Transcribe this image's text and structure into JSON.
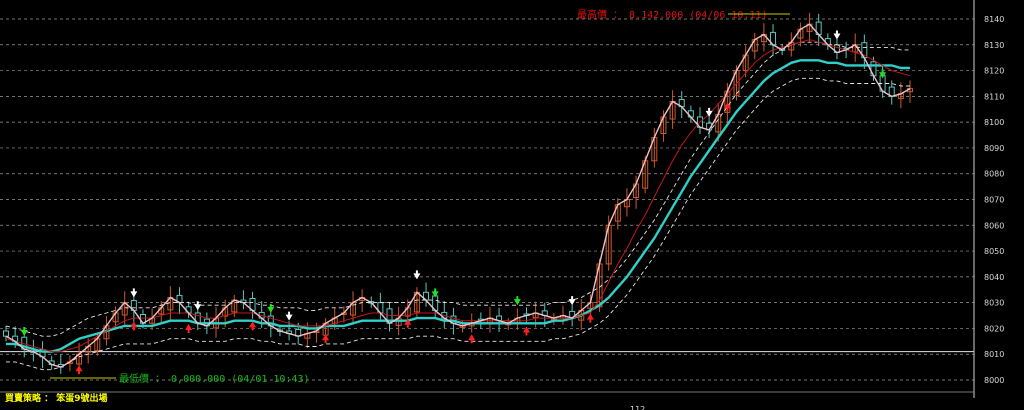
{
  "chart_data": {
    "type": "candlestick",
    "y_axis": {
      "ticks": [
        8140,
        8130,
        8120,
        8110,
        8100,
        8090,
        8080,
        8070,
        8060,
        8050,
        8040,
        8030,
        8020,
        8010,
        8000
      ],
      "min": 7995,
      "max": 8145,
      "reference_line": 8011
    },
    "annotations": {
      "high": "最高價 ： 8,142.000 (04/06 10:11)",
      "low": "最低價 ： 0,000.000 (04/01 10:43)"
    },
    "series": [
      {
        "key": "close",
        "values": [
          8017,
          8015,
          8012,
          8011,
          8009,
          8006,
          8005,
          8007,
          8010,
          8013,
          8016,
          8021,
          8026,
          8030,
          8027,
          8022,
          8024,
          8028,
          8032,
          8030,
          8026,
          8022,
          8021,
          8024,
          8028,
          8031,
          8030,
          8027,
          8024,
          8021,
          8019,
          8018,
          8017,
          8018,
          8019,
          8022,
          8024,
          8026,
          8030,
          8032,
          8030,
          8026,
          8022,
          8024,
          8028,
          8034,
          8031,
          8027,
          8024,
          8022,
          8021,
          8022,
          8023,
          8024,
          8023,
          8022,
          8024,
          8025,
          8026,
          8025,
          8024,
          8025,
          8024,
          8027,
          8030,
          8045,
          8060,
          8068,
          8070,
          8076,
          8085,
          8094,
          8102,
          8108,
          8106,
          8102,
          8098,
          8097,
          8103,
          8112,
          8120,
          8126,
          8132,
          8134,
          8130,
          8128,
          8131,
          8136,
          8138,
          8134,
          8130,
          8127,
          8128,
          8130,
          8125,
          8118,
          8112,
          8110,
          8111,
          8113
        ]
      },
      {
        "key": "upper_band",
        "values": [
          8021,
          8020,
          8019,
          8018,
          8017,
          8017,
          8018,
          8020,
          8022,
          8024,
          8025,
          8026,
          8027,
          8028,
          8028,
          8028,
          8028,
          8029,
          8030,
          8030,
          8030,
          8029,
          8029,
          8029,
          8029,
          8030,
          8030,
          8030,
          8029,
          8029,
          8028,
          8028,
          8028,
          8027,
          8027,
          8028,
          8028,
          8028,
          8029,
          8030,
          8030,
          8030,
          8030,
          8030,
          8030,
          8031,
          8031,
          8031,
          8030,
          8030,
          8029,
          8029,
          8029,
          8029,
          8029,
          8029,
          8029,
          8029,
          8029,
          8029,
          8030,
          8030,
          8031,
          8032,
          8034,
          8036,
          8039,
          8043,
          8047,
          8052,
          8057,
          8062,
          8068,
          8074,
          8080,
          8086,
          8091,
          8096,
          8101,
          8106,
          8111,
          8115,
          8119,
          8123,
          8126,
          8128,
          8130,
          8131,
          8131,
          8131,
          8130,
          8130,
          8129,
          8129,
          8129,
          8129,
          8129,
          8129,
          8128,
          8128
        ]
      },
      {
        "key": "middle",
        "values": [
          8014,
          8014,
          8013,
          8012,
          8011,
          8011,
          8012,
          8014,
          8016,
          8017,
          8018,
          8019,
          8020,
          8021,
          8021,
          8021,
          8021,
          8022,
          8023,
          8023,
          8023,
          8022,
          8022,
          8022,
          8022,
          8023,
          8023,
          8023,
          8022,
          8022,
          8021,
          8021,
          8021,
          8020,
          8020,
          8021,
          8021,
          8021,
          8022,
          8023,
          8023,
          8023,
          8023,
          8023,
          8023,
          8024,
          8024,
          8024,
          8023,
          8023,
          8022,
          8022,
          8022,
          8022,
          8022,
          8022,
          8022,
          8022,
          8022,
          8022,
          8023,
          8023,
          8024,
          8025,
          8027,
          8029,
          8032,
          8036,
          8040,
          8045,
          8050,
          8055,
          8061,
          8067,
          8073,
          8079,
          8084,
          8089,
          8094,
          8099,
          8104,
          8108,
          8112,
          8116,
          8119,
          8121,
          8123,
          8124,
          8124,
          8124,
          8123,
          8123,
          8122,
          8122,
          8122,
          8122,
          8122,
          8122,
          8121,
          8121
        ]
      },
      {
        "key": "lower_band",
        "values": [
          8007,
          8007,
          8006,
          8005,
          8004,
          8004,
          8005,
          8007,
          8009,
          8010,
          8011,
          8012,
          8013,
          8014,
          8014,
          8014,
          8014,
          8015,
          8016,
          8016,
          8016,
          8015,
          8015,
          8015,
          8015,
          8016,
          8016,
          8016,
          8015,
          8015,
          8014,
          8014,
          8014,
          8013,
          8013,
          8014,
          8014,
          8014,
          8015,
          8016,
          8016,
          8016,
          8016,
          8016,
          8016,
          8017,
          8017,
          8017,
          8016,
          8016,
          8015,
          8015,
          8015,
          8015,
          8015,
          8015,
          8015,
          8015,
          8015,
          8015,
          8016,
          8016,
          8017,
          8018,
          8020,
          8022,
          8025,
          8029,
          8033,
          8038,
          8043,
          8048,
          8054,
          8060,
          8066,
          8072,
          8077,
          8082,
          8087,
          8092,
          8097,
          8101,
          8105,
          8109,
          8112,
          8114,
          8116,
          8117,
          8117,
          8117,
          8116,
          8116,
          8115,
          8115,
          8115,
          8115,
          8115,
          8115,
          8114,
          8114
        ]
      },
      {
        "key": "slow_ma",
        "values": [
          8016,
          8015,
          8014,
          8013,
          8012,
          8011,
          8011,
          8012,
          8013,
          8015,
          8017,
          8019,
          8021,
          8023,
          8024,
          8024,
          8024,
          8025,
          8026,
          8026,
          8026,
          8025,
          8024,
          8024,
          8025,
          8026,
          8026,
          8026,
          8025,
          8024,
          8023,
          8022,
          8021,
          8021,
          8021,
          8021,
          8022,
          8023,
          8024,
          8025,
          8026,
          8026,
          8025,
          8025,
          8025,
          8026,
          8026,
          8026,
          8025,
          8024,
          8023,
          8023,
          8023,
          8023,
          8023,
          8023,
          8023,
          8023,
          8024,
          8024,
          8024,
          8024,
          8024,
          8025,
          8026,
          8031,
          8038,
          8045,
          8051,
          8058,
          8064,
          8071,
          8078,
          8085,
          8091,
          8096,
          8100,
          8103,
          8107,
          8111,
          8115,
          8119,
          8123,
          8126,
          8128,
          8129,
          8130,
          8131,
          8132,
          8131,
          8130,
          8129,
          8128,
          8127,
          8126,
          8124,
          8122,
          8120,
          8119,
          8118
        ]
      }
    ],
    "signals_up": [
      8,
      14,
      20,
      27,
      35,
      44,
      51,
      57,
      64,
      79
    ],
    "signals_down": [
      14,
      21,
      31,
      45,
      62,
      77,
      91
    ],
    "signals_down_green": [
      2,
      29,
      47,
      56,
      96
    ]
  },
  "footer": {
    "strategy_label": "買賣策略 ： 笨蛋9號出場",
    "mid_mark": "112"
  },
  "colors": {
    "background": "#000000",
    "up_candle": "#cc5a2a",
    "down_candle": "#58c8c0",
    "middle_band": "#2fd0c8",
    "bands": "#e8e8e8",
    "close_line": "#f0c0c8",
    "slow_ma": "#c01818",
    "grid": "#9a9a9a"
  }
}
